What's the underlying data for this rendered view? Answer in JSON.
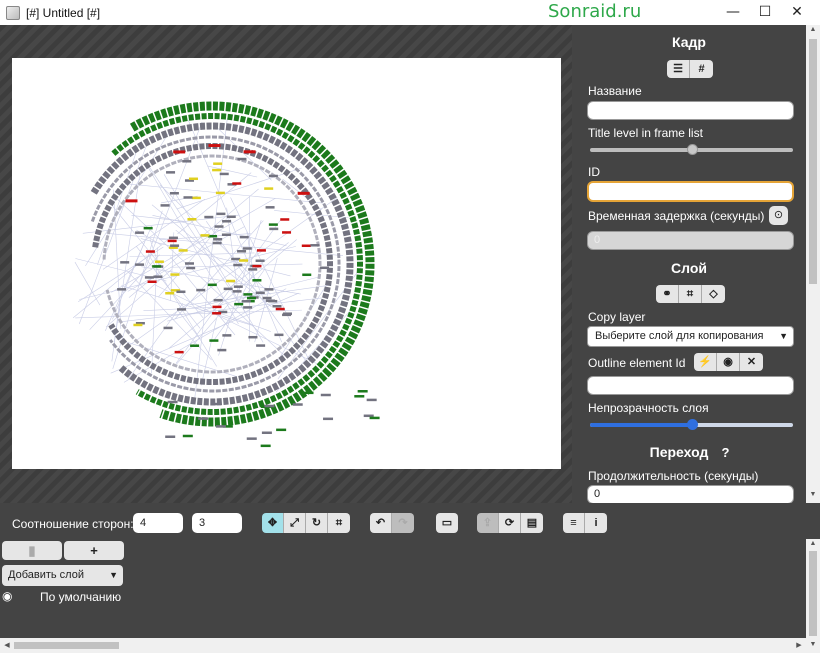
{
  "window": {
    "title": "[#] Untitled [#]",
    "watermark": "Sonraid.ru",
    "minimize": "—",
    "maximize": "☐",
    "close": "✕"
  },
  "panel": {
    "frame_header": "Кадр",
    "name_label": "Название",
    "name_value": "",
    "title_level_label": "Title level in frame list",
    "title_level_fraction": 0.5,
    "id_label": "ID",
    "id_value": "",
    "delay_label": "Временная задержка (секунды)",
    "delay_value": "0",
    "layer_header": "Слой",
    "copy_layer_label": "Copy layer",
    "copy_layer_select": "Выберите слой для копирования",
    "outline_label": "Outline element Id",
    "outline_value": "",
    "opacity_label": "Непрозрачность слоя",
    "opacity_fraction": 0.5,
    "transition_header": "Переход",
    "duration_label": "Продолжительность (секунды)",
    "duration_value": "0"
  },
  "toolbar": {
    "aspect_label": "Соотношение сторон:",
    "aspect_w": "4",
    "aspect_h": "3"
  },
  "layers": {
    "add_layer_select": "Добавить слой",
    "add_button": "+",
    "layer_items": [
      "По умолчанию"
    ]
  },
  "colors": {
    "accent_blue": "#2f6fe0",
    "focus_orange": "#e5a437",
    "active_tool": "#a3e1ea",
    "panel_bg": "#444444"
  }
}
